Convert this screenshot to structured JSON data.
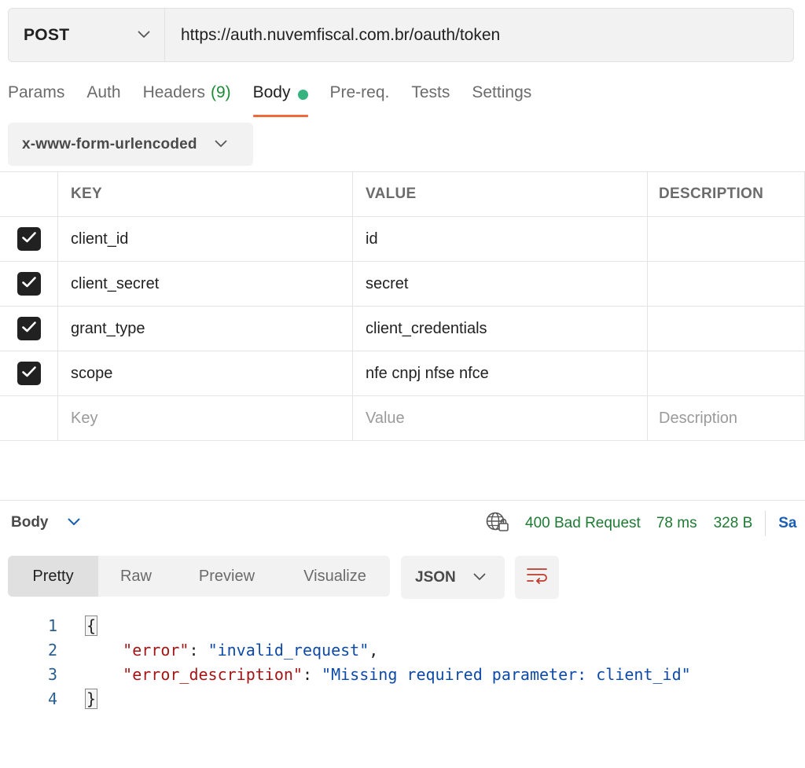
{
  "request": {
    "method": "POST",
    "url": "https://auth.nuvemfiscal.com.br/oauth/token"
  },
  "tabs": [
    {
      "label": "Params"
    },
    {
      "label": "Auth"
    },
    {
      "label": "Headers",
      "count": "(9)"
    },
    {
      "label": "Body",
      "active": true
    },
    {
      "label": "Pre-req."
    },
    {
      "label": "Tests"
    },
    {
      "label": "Settings"
    }
  ],
  "body_type": "x-www-form-urlencoded",
  "params_table": {
    "headers": [
      "KEY",
      "VALUE",
      "DESCRIPTION"
    ],
    "rows": [
      {
        "key": "client_id",
        "value": "id",
        "description": "",
        "checked": true
      },
      {
        "key": "client_secret",
        "value": "secret",
        "description": "",
        "checked": true
      },
      {
        "key": "grant_type",
        "value": "client_credentials",
        "description": "",
        "checked": true
      },
      {
        "key": "scope",
        "value": "nfe cnpj nfse nfce",
        "description": "",
        "checked": true
      }
    ],
    "placeholder": {
      "key": "Key",
      "value": "Value",
      "description": "Description"
    }
  },
  "response": {
    "title": "Body",
    "status": "400 Bad Request",
    "time": "78 ms",
    "size": "328 B",
    "save_label_partial": "Sa",
    "status_color": "#1f7a34",
    "view_modes": [
      "Pretty",
      "Raw",
      "Preview",
      "Visualize"
    ],
    "active_view": "Pretty",
    "format": "JSON",
    "code": {
      "line_numbers": [
        "1",
        "2",
        "3",
        "4"
      ],
      "open_brace": "{",
      "close_brace": "}",
      "lines": [
        {
          "key": "\"error\"",
          "sep": ": ",
          "value": "\"invalid_request\"",
          "trail": ","
        },
        {
          "key": "\"error_description\"",
          "sep": ": ",
          "value": "\"Missing required parameter: client_id\"",
          "trail": ""
        }
      ]
    }
  },
  "icons": {
    "method_dropdown": "chevron-down-icon",
    "checkbox": "checkmark-icon",
    "status_network": "globe-lock-icon",
    "wrap": "wrap-lines-icon"
  },
  "colors": {
    "accent_tab_underline": "#ee6a3b",
    "body_dot": "#36b37e",
    "json_key": "#a31515",
    "json_string": "#0d4aa8"
  }
}
